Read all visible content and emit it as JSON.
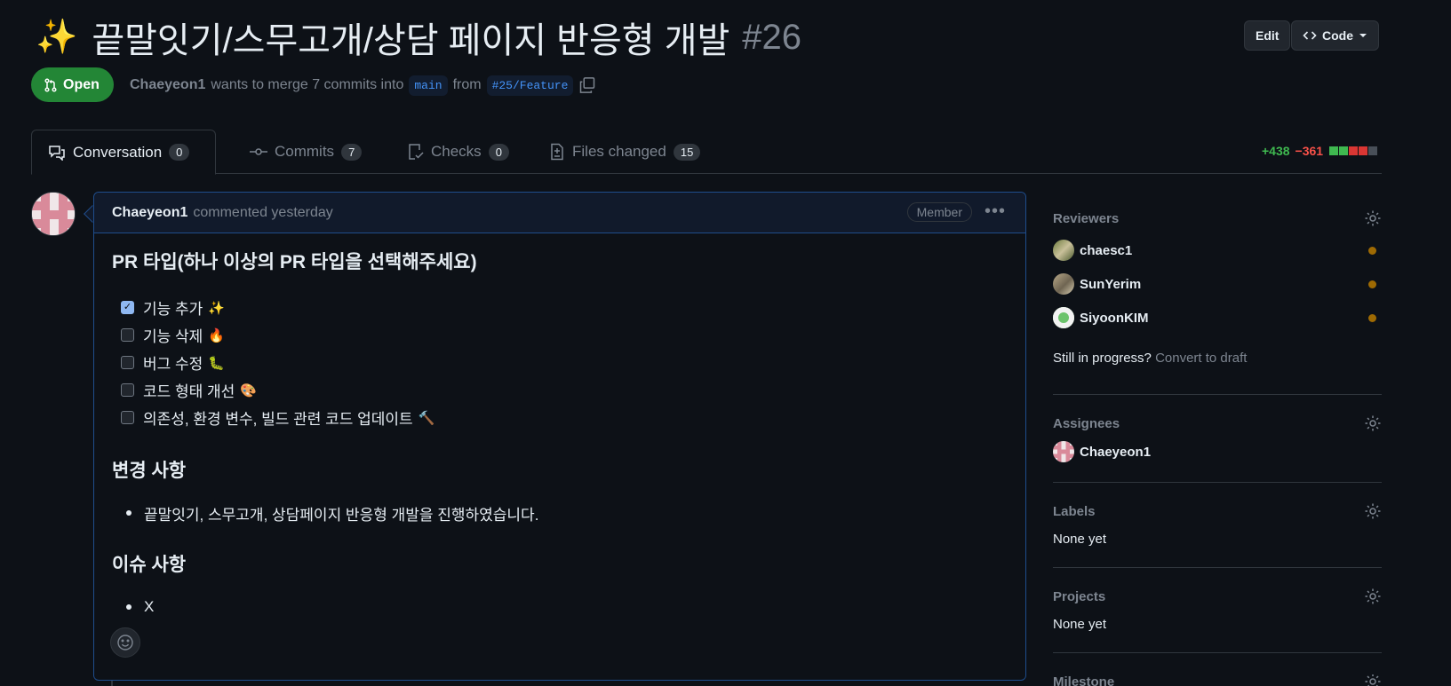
{
  "pr": {
    "title_emoji": "✨",
    "title": "끝말잇기/스무고개/상담 페이지 반응형 개발",
    "number": "#26",
    "status": "Open",
    "author": "Chaeyeon1",
    "merge_text": "wants to merge 7 commits into",
    "base_branch": "main",
    "from_text": "from",
    "head_branch": "#25/Feature"
  },
  "header": {
    "edit_label": "Edit",
    "code_label": "Code"
  },
  "tabs": [
    {
      "label": "Conversation",
      "count": "0"
    },
    {
      "label": "Commits",
      "count": "7"
    },
    {
      "label": "Checks",
      "count": "0"
    },
    {
      "label": "Files changed",
      "count": "15"
    }
  ],
  "diffstat": {
    "additions": "+438",
    "deletions": "−361"
  },
  "comment": {
    "author": "Chaeyeon1",
    "action": "commented yesterday",
    "badge": "Member",
    "heading_type": "PR 타입(하나 이상의 PR 타입을 선택해주세요)",
    "checklist": [
      {
        "label": "기능 추가",
        "emoji": "✨",
        "checked": true
      },
      {
        "label": "기능 삭제",
        "emoji": "🔥",
        "checked": false
      },
      {
        "label": "버그 수정",
        "emoji": "🐛",
        "checked": false
      },
      {
        "label": "코드 형태 개선",
        "emoji": "🎨",
        "checked": false
      },
      {
        "label": "의존성, 환경 변수, 빌드 관련 코드 업데이트",
        "emoji": "🔨",
        "checked": false
      }
    ],
    "heading_changes": "변경 사항",
    "changes": [
      "끝말잇기, 스무고개, 상담페이지 반응형 개발을 진행하였습니다."
    ],
    "heading_issues": "이슈 사항",
    "issues": [
      "X"
    ]
  },
  "sidebar": {
    "reviewers_title": "Reviewers",
    "reviewers": [
      "chaesc1",
      "SunYerim",
      "SiyoonKIM"
    ],
    "still_in_progress": "Still in progress?",
    "convert_to_draft": "Convert to draft",
    "assignees_title": "Assignees",
    "assignees": [
      "Chaeyeon1"
    ],
    "labels_title": "Labels",
    "labels_value": "None yet",
    "projects_title": "Projects",
    "projects_value": "None yet",
    "milestone_title": "Milestone"
  },
  "colors": {
    "open_green": "#238636",
    "accent_blue": "#4493f8",
    "pending_dot": "#9e6a03"
  }
}
